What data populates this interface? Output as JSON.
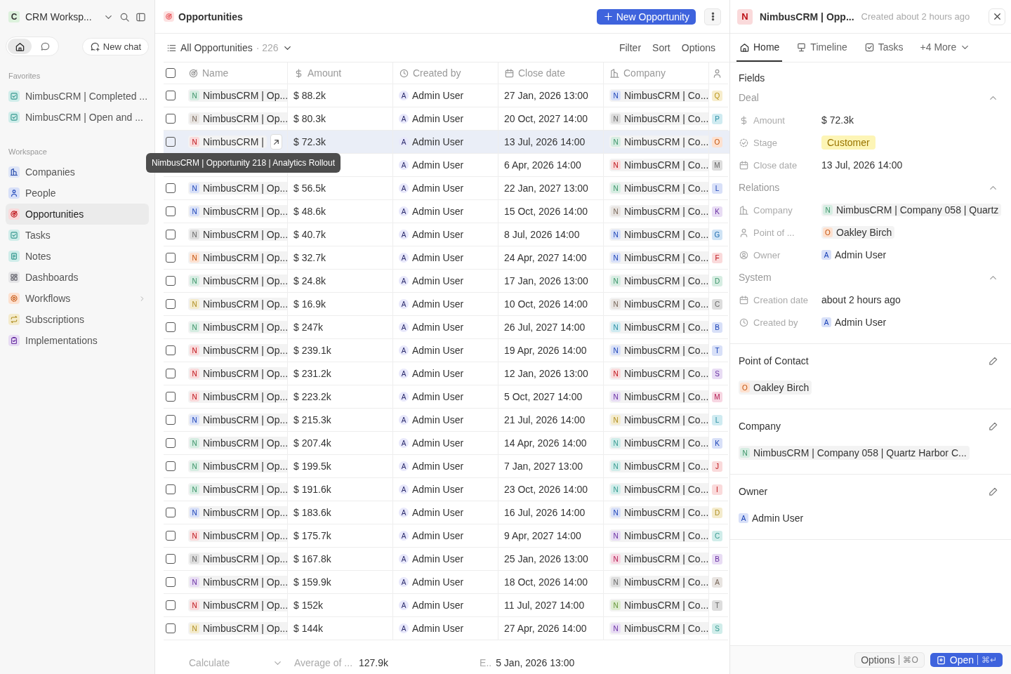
{
  "sidebar": {
    "workspace": {
      "initial": "C",
      "name": "CRM Worksp..."
    },
    "modes": [
      {
        "selected": true
      },
      {
        "selected": false
      }
    ],
    "new_chat": "New chat",
    "favorites_label": "Favorites",
    "favorites": [
      {
        "label": "NimbusCRM | Completed ...",
        "color": "#d0edea"
      },
      {
        "label": "NimbusCRM | Open and ...",
        "color": "#d0edea"
      }
    ],
    "workspace_label": "Workspace",
    "items": [
      {
        "label": "Companies",
        "color": "#dee5f7",
        "selected": false,
        "expandable": false
      },
      {
        "label": "People",
        "color": "#d8e0f8",
        "selected": false,
        "expandable": false
      },
      {
        "label": "Opportunities",
        "color": "#fadadb",
        "selected": true,
        "expandable": false
      },
      {
        "label": "Tasks",
        "color": "#d0edea",
        "selected": false,
        "expandable": false
      },
      {
        "label": "Notes",
        "color": "#d0edea",
        "selected": false,
        "expandable": false
      },
      {
        "label": "Dashboards",
        "color": "#e6e6e8",
        "selected": false,
        "expandable": false
      },
      {
        "label": "Workflows",
        "color": "#fde1d0",
        "selected": false,
        "expandable": true
      },
      {
        "label": "Subscriptions",
        "color": "#f4ebcc",
        "selected": false,
        "expandable": false
      },
      {
        "label": "Implementations",
        "color": "#e8dcf4",
        "selected": false,
        "expandable": false
      }
    ]
  },
  "main": {
    "title": "Opportunities",
    "new_button": "New Opportunity",
    "view": {
      "name": "All Opportunities",
      "count": "· 226"
    },
    "actions": [
      "Filter",
      "Sort",
      "Options"
    ],
    "all_checked": false,
    "columns": [
      "Name",
      "Amount",
      "Created by",
      "Close date",
      "Company"
    ],
    "rows": [
      {
        "checked": false,
        "hovered": false,
        "name": {
          "initial": "N",
          "color": "#d6ede2",
          "label": "NimbusCRM | Op..."
        },
        "amount": "$ 88.2k",
        "creator": {
          "initial": "A",
          "label": "Admin User"
        },
        "close_date": "27 Jan, 2026 13:00",
        "company": {
          "initial": "N",
          "color": "#d8e0f8",
          "label": "NimbusCRM | Co..."
        },
        "contact": {
          "initial": "Q",
          "color": "#f7edcc"
        }
      },
      {
        "checked": false,
        "hovered": false,
        "name": {
          "initial": "N",
          "color": "#e8e4e1",
          "label": "NimbusCRM | Op..."
        },
        "amount": "$ 80.3k",
        "creator": {
          "initial": "A",
          "label": "Admin User"
        },
        "close_date": "20 Oct, 2027 14:00",
        "company": {
          "initial": "N",
          "color": "#dddddd",
          "label": "NimbusCRM | Co..."
        },
        "contact": {
          "initial": "P",
          "color": "#cfebf1"
        }
      },
      {
        "checked": false,
        "hovered": true,
        "name": {
          "initial": "N",
          "color": "#fadadb",
          "label": "NimbusCRM |"
        },
        "amount": "$ 72.3k",
        "creator": {
          "initial": "A",
          "label": "Admin User"
        },
        "close_date": "13 Jul, 2026 14:00",
        "company": {
          "initial": "N",
          "color": "#d6ede2",
          "label": "NimbusCRM | Co..."
        },
        "contact": {
          "initial": "O",
          "color": "#fde1d0"
        }
      },
      {
        "hovered": false,
        "creator": {
          "initial": "A",
          "label": "Admin User"
        },
        "close_date": "6 Apr, 2026 14:00",
        "company": {
          "initial": "N",
          "color": "#fadadb",
          "label": "NimbusCRM | Co..."
        },
        "contact": {
          "initial": "M",
          "color": "#dddddd"
        }
      },
      {
        "checked": false,
        "hovered": false,
        "name": {
          "initial": "N",
          "color": "#d8e0f8",
          "label": "NimbusCRM | Op..."
        },
        "amount": "$ 56.5k",
        "creator": {
          "initial": "A",
          "label": "Admin User"
        },
        "close_date": "22 Jan, 2027 13:00",
        "company": {
          "initial": "N",
          "color": "#d6ede2",
          "label": "NimbusCRM | Co..."
        },
        "contact": {
          "initial": "L",
          "color": "#d8e0f8"
        }
      },
      {
        "checked": false,
        "hovered": false,
        "name": {
          "initial": "N",
          "color": "#d8e0f8",
          "label": "NimbusCRM | Op..."
        },
        "amount": "$ 48.6k",
        "creator": {
          "initial": "A",
          "label": "Admin User"
        },
        "close_date": "15 Oct, 2026 14:00",
        "company": {
          "initial": "N",
          "color": "#e8e4e1",
          "label": "NimbusCRM | Co..."
        },
        "contact": {
          "initial": "K",
          "color": "#e8dcf4"
        }
      },
      {
        "checked": false,
        "hovered": false,
        "name": {
          "initial": "N",
          "color": "#dddddd",
          "label": "NimbusCRM | Op..."
        },
        "amount": "$ 40.7k",
        "creator": {
          "initial": "A",
          "label": "Admin User"
        },
        "close_date": "8 Jul, 2026 14:00",
        "company": {
          "initial": "N",
          "color": "#d8e0f8",
          "label": "NimbusCRM | Co..."
        },
        "contact": {
          "initial": "G",
          "color": "#cfe3f5"
        }
      },
      {
        "checked": false,
        "hovered": false,
        "name": {
          "initial": "N",
          "color": "#fde1d0",
          "label": "NimbusCRM | Op..."
        },
        "amount": "$ 32.7k",
        "creator": {
          "initial": "A",
          "label": "Admin User"
        },
        "close_date": "24 Apr, 2027 14:00",
        "company": {
          "initial": "N",
          "color": "#d8e0f8",
          "label": "NimbusCRM | Co..."
        },
        "contact": {
          "initial": "F",
          "color": "#fadadb"
        }
      },
      {
        "checked": false,
        "hovered": false,
        "name": {
          "initial": "N",
          "color": "#d6ede2",
          "label": "NimbusCRM | Op..."
        },
        "amount": "$ 24.8k",
        "creator": {
          "initial": "A",
          "label": "Admin User"
        },
        "close_date": "17 Jan, 2026 13:00",
        "company": {
          "initial": "N",
          "color": "#d6ede2",
          "label": "NimbusCRM | Co..."
        },
        "contact": {
          "initial": "D",
          "color": "#d6ede2"
        }
      },
      {
        "checked": false,
        "hovered": false,
        "name": {
          "initial": "N",
          "color": "#f4ebcc",
          "label": "NimbusCRM | Op..."
        },
        "amount": "$ 16.9k",
        "creator": {
          "initial": "A",
          "label": "Admin User"
        },
        "close_date": "10 Oct, 2026 14:00",
        "company": {
          "initial": "N",
          "color": "#e8e4e1",
          "label": "NimbusCRM | Co..."
        },
        "contact": {
          "initial": "C",
          "color": "#dddddd"
        }
      },
      {
        "checked": false,
        "hovered": false,
        "name": {
          "initial": "N",
          "color": "#d6ede2",
          "label": "NimbusCRM | Op..."
        },
        "amount": "$ 247k",
        "creator": {
          "initial": "A",
          "label": "Admin User"
        },
        "close_date": "26 Jul, 2027 14:00",
        "company": {
          "initial": "N",
          "color": "#cfebf1",
          "label": "NimbusCRM | Co..."
        },
        "contact": {
          "initial": "B",
          "color": "#d8e0f8"
        }
      },
      {
        "checked": false,
        "hovered": false,
        "name": {
          "initial": "N",
          "color": "#fadadb",
          "label": "NimbusCRM | Op..."
        },
        "amount": "$ 239.1k",
        "creator": {
          "initial": "A",
          "label": "Admin User"
        },
        "close_date": "19 Apr, 2026 14:00",
        "company": {
          "initial": "N",
          "color": "#d8e0f8",
          "label": "NimbusCRM | Co..."
        },
        "contact": {
          "initial": "T",
          "color": "#d8e0f8"
        }
      },
      {
        "checked": false,
        "hovered": false,
        "name": {
          "initial": "N",
          "color": "#fadadb",
          "label": "NimbusCRM | Op..."
        },
        "amount": "$ 231.2k",
        "creator": {
          "initial": "A",
          "label": "Admin User"
        },
        "close_date": "12 Jan, 2026 13:00",
        "company": {
          "initial": "N",
          "color": "#fadadb",
          "label": "NimbusCRM | Co..."
        },
        "contact": {
          "initial": "S",
          "color": "#e8dcf4"
        }
      },
      {
        "checked": false,
        "hovered": false,
        "name": {
          "initial": "N",
          "color": "#fadadb",
          "label": "NimbusCRM | Op..."
        },
        "amount": "$ 223.2k",
        "creator": {
          "initial": "A",
          "label": "Admin User"
        },
        "close_date": "5 Oct, 2027 14:00",
        "company": {
          "initial": "N",
          "color": "#e8dcf4",
          "label": "NimbusCRM | Co..."
        },
        "contact": {
          "initial": "M",
          "color": "#f7d6e2"
        }
      },
      {
        "checked": false,
        "hovered": false,
        "name": {
          "initial": "N",
          "color": "#d8e0f8",
          "label": "NimbusCRM | Op..."
        },
        "amount": "$ 215.3k",
        "creator": {
          "initial": "A",
          "label": "Admin User"
        },
        "close_date": "21 Jul, 2026 14:00",
        "company": {
          "initial": "N",
          "color": "#f4ebcc",
          "label": "NimbusCRM | Co..."
        },
        "contact": {
          "initial": "L",
          "color": "#cfebf1"
        }
      },
      {
        "checked": false,
        "hovered": false,
        "name": {
          "initial": "N",
          "color": "#d6ede2",
          "label": "NimbusCRM | Op..."
        },
        "amount": "$ 207.4k",
        "creator": {
          "initial": "A",
          "label": "Admin User"
        },
        "close_date": "14 Apr, 2026 14:00",
        "company": {
          "initial": "N",
          "color": "#d0edea",
          "label": "NimbusCRM | Co..."
        },
        "contact": {
          "initial": "K",
          "color": "#d8e0f8"
        }
      },
      {
        "checked": false,
        "hovered": false,
        "name": {
          "initial": "N",
          "color": "#d6ede2",
          "label": "NimbusCRM | Op..."
        },
        "amount": "$ 199.5k",
        "creator": {
          "initial": "A",
          "label": "Admin User"
        },
        "close_date": "7 Jan, 2027 13:00",
        "company": {
          "initial": "N",
          "color": "#d0edea",
          "label": "NimbusCRM | Co..."
        },
        "contact": {
          "initial": "J",
          "color": "#fadadb"
        }
      },
      {
        "checked": false,
        "hovered": false,
        "name": {
          "initial": "N",
          "color": "#d6ede2",
          "label": "NimbusCRM | Op..."
        },
        "amount": "$ 191.6k",
        "creator": {
          "initial": "A",
          "label": "Admin User"
        },
        "close_date": "23 Oct, 2026 14:00",
        "company": {
          "initial": "N",
          "color": "#d0edea",
          "label": "NimbusCRM | Co..."
        },
        "contact": {
          "initial": "I",
          "color": "#fadadb"
        }
      },
      {
        "checked": false,
        "hovered": false,
        "name": {
          "initial": "N",
          "color": "#d8e0f8",
          "label": "NimbusCRM | Op..."
        },
        "amount": "$ 183.6k",
        "creator": {
          "initial": "A",
          "label": "Admin User"
        },
        "close_date": "16 Jul, 2026 14:00",
        "company": {
          "initial": "N",
          "color": "#d8e0f8",
          "label": "NimbusCRM | Co..."
        },
        "contact": {
          "initial": "D",
          "color": "#f4ebcc"
        }
      },
      {
        "checked": false,
        "hovered": false,
        "name": {
          "initial": "N",
          "color": "#fadadb",
          "label": "NimbusCRM | Op..."
        },
        "amount": "$ 175.7k",
        "creator": {
          "initial": "A",
          "label": "Admin User"
        },
        "close_date": "9 Apr, 2027 14:00",
        "company": {
          "initial": "N",
          "color": "#e8dcf4",
          "label": "NimbusCRM | Co..."
        },
        "contact": {
          "initial": "C",
          "color": "#d0edea"
        }
      },
      {
        "checked": false,
        "hovered": false,
        "name": {
          "initial": "N",
          "color": "#dddddd",
          "label": "NimbusCRM | Op..."
        },
        "amount": "$ 167.8k",
        "creator": {
          "initial": "A",
          "label": "Admin User"
        },
        "close_date": "25 Jan, 2026 13:00",
        "company": {
          "initial": "N",
          "color": "#f7d6e2",
          "label": "NimbusCRM | Co..."
        },
        "contact": {
          "initial": "B",
          "color": "#e8dcf4"
        }
      },
      {
        "checked": false,
        "hovered": false,
        "name": {
          "initial": "N",
          "color": "#e8dcf4",
          "label": "NimbusCRM | Op..."
        },
        "amount": "$ 159.9k",
        "creator": {
          "initial": "A",
          "label": "Admin User"
        },
        "close_date": "18 Oct, 2026 14:00",
        "company": {
          "initial": "N",
          "color": "#dddddd",
          "label": "NimbusCRM | Co..."
        },
        "contact": {
          "initial": "A",
          "color": "#e8e4e1"
        }
      },
      {
        "checked": false,
        "hovered": false,
        "name": {
          "initial": "N",
          "color": "#fadadb",
          "label": "NimbusCRM | Op..."
        },
        "amount": "$ 152k",
        "creator": {
          "initial": "A",
          "label": "Admin User"
        },
        "close_date": "11 Jul, 2027 14:00",
        "company": {
          "initial": "N",
          "color": "#deecd1",
          "label": "NimbusCRM | Co..."
        },
        "contact": {
          "initial": "T",
          "color": "#dddddd"
        }
      },
      {
        "checked": false,
        "hovered": false,
        "name": {
          "initial": "N",
          "color": "#f4ebcc",
          "label": "NimbusCRM | Op..."
        },
        "amount": "$ 144k",
        "creator": {
          "initial": "A",
          "label": "Admin User"
        },
        "close_date": "27 Apr, 2026 14:00",
        "company": {
          "initial": "N",
          "color": "#e8dcf4",
          "label": "NimbusCRM | Co..."
        },
        "contact": {
          "initial": "S",
          "color": "#d0edea"
        }
      }
    ],
    "tooltip": "NimbusCRM | Opportunity 218 | Analytics Rollout",
    "footer": {
      "calculate": "Calculate",
      "aggregate_label": "Average of ...",
      "aggregate_value": "127.9k",
      "date_label": "E..",
      "date_value": "5 Jan, 2026 13:00"
    }
  },
  "record": {
    "avatar": {
      "initial": "N",
      "color": "#fadadb"
    },
    "title": "NimbusCRM | Opp...",
    "created": "Created about 2 hours ago",
    "tabs": [
      {
        "label": "Home",
        "selected": true
      },
      {
        "label": "Timeline",
        "selected": false
      },
      {
        "label": "Tasks",
        "selected": false
      },
      {
        "label": "+4 More",
        "selected": false
      }
    ],
    "fields_title": "Fields",
    "sections": [
      {
        "title": "Deal",
        "expanded": true,
        "fields": [
          {
            "label": "Amount",
            "kind": "text",
            "value": "$ 72.3k"
          },
          {
            "label": "Stage",
            "kind": "tag",
            "value": "Customer"
          },
          {
            "label": "Close date",
            "kind": "text",
            "value": "13 Jul, 2026 14:00"
          }
        ]
      },
      {
        "title": "Relations",
        "expanded": true,
        "fields": [
          {
            "label": "Company",
            "kind": "chip",
            "initial": "N",
            "color": "#d6ede2",
            "value": "NimbusCRM | Company 058 | Quartz"
          },
          {
            "label": "Point of ...",
            "kind": "chip",
            "initial": "O",
            "color": "#fde1d0",
            "value": "Oakley Birch"
          },
          {
            "label": "Owner",
            "kind": "person",
            "initial": "A",
            "color": "#d8e0f8",
            "value": "Admin User"
          }
        ]
      },
      {
        "title": "System",
        "expanded": true,
        "fields": [
          {
            "label": "Creation date",
            "kind": "text",
            "value": "about 2 hours ago"
          },
          {
            "label": "Created by",
            "kind": "person",
            "initial": "A",
            "color": "#d8e0f8",
            "value": "Admin User"
          }
        ]
      }
    ],
    "cards": [
      {
        "title": "Point of Contact",
        "kind": "chip",
        "initial": "O",
        "color": "#fde1d0",
        "value": "Oakley Birch"
      },
      {
        "title": "Company",
        "kind": "chip",
        "initial": "N",
        "color": "#d6ede2",
        "value": "NimbusCRM | Company 058 | Quartz Harbor C..."
      },
      {
        "title": "Owner",
        "kind": "person",
        "initial": "A",
        "color": "#d8e0f8",
        "value": "Admin User"
      }
    ],
    "footer": {
      "options": "Options",
      "options_shortcut": "⌘O",
      "open": "Open",
      "open_shortcut": "⌘↵"
    }
  }
}
